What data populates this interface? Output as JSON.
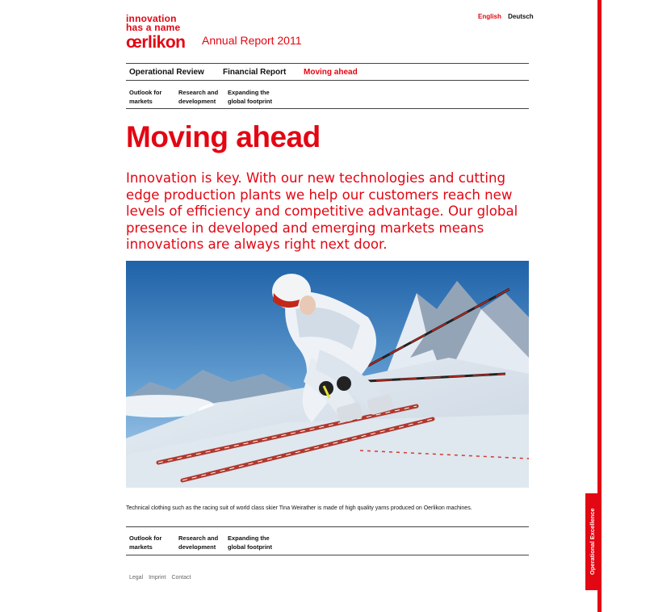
{
  "brand": {
    "tagline_line1": "innovation",
    "tagline_line2": "has a name",
    "logo": "œrlikon",
    "report_title": "Annual Report 2011"
  },
  "languages": {
    "active": "English",
    "other": "Deutsch"
  },
  "main_nav": [
    {
      "label": "Operational Review"
    },
    {
      "label": "Financial Report"
    },
    {
      "label": "Moving ahead",
      "active": true
    }
  ],
  "sub_nav": [
    {
      "line1": "Outlook for",
      "line2": "markets"
    },
    {
      "line1": "Research and",
      "line2": "development"
    },
    {
      "line1": "Expanding the",
      "line2": "global footprint"
    }
  ],
  "page": {
    "title": "Moving ahead",
    "intro": "Innovation is key. With our new technologies and cutting edge production plants we help our customers reach new levels of efficiency and competitive advantage. Our global presence in developed and emerging markets means innovations are always right next door.",
    "caption": "Technical clothing such as the racing suit of world class skier Tina Weirather is made of high quality yarns produced on Oerlikon machines."
  },
  "footer": {
    "legal": "Legal",
    "imprint": "Imprint",
    "contact": "Contact"
  },
  "side_tab": {
    "label": "Operational Excellence"
  },
  "colors": {
    "accent": "#e30613"
  }
}
